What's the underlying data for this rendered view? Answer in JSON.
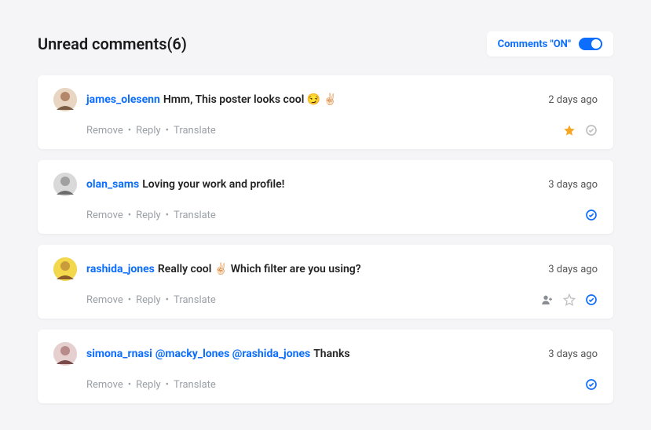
{
  "header": {
    "title": "Unread comments(6)",
    "toggle_label": "Comments \"ON\""
  },
  "actions": {
    "remove": "Remove",
    "reply": "Reply",
    "translate": "Translate"
  },
  "comments": [
    {
      "username": "james_olesenn",
      "body": "Hmm, This poster looks cool 😏 ✌🏻",
      "time": "2 days ago"
    },
    {
      "username": "olan_sams",
      "body": "Loving your work and profile!",
      "time": "3 days ago"
    },
    {
      "username": "rashida_jones",
      "body": "Really cool ✌🏻 Which filter are you using?",
      "time": "3 days ago"
    },
    {
      "username": "simona_rnasi",
      "mentions": "@macky_lones @rashida_jones",
      "body": "Thanks",
      "time": "3 days ago"
    }
  ]
}
